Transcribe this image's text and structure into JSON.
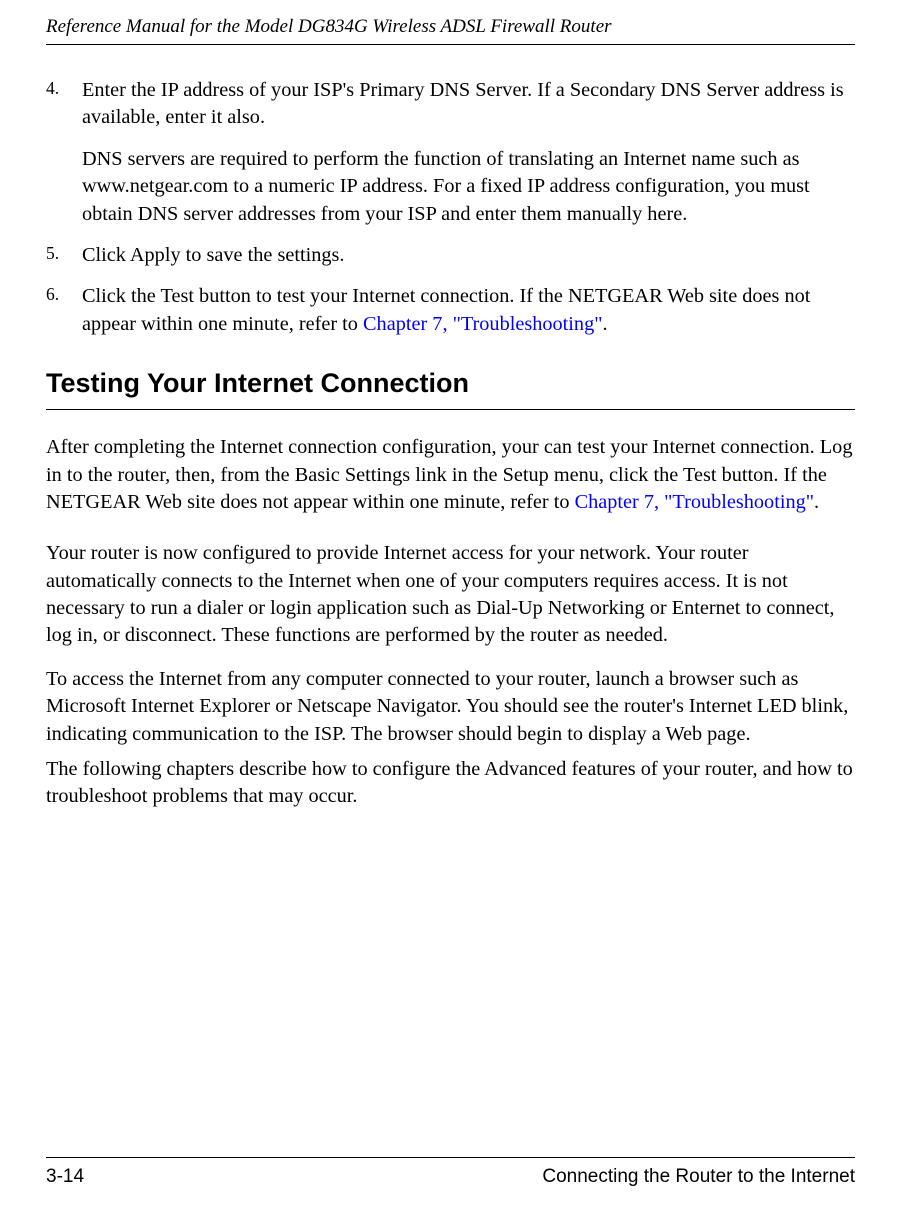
{
  "header": {
    "title": "Reference Manual for the Model DG834G Wireless ADSL Firewall Router"
  },
  "list": {
    "item4": {
      "num": "4.",
      "text": "Enter the IP address of your ISP's Primary DNS Server. If a Secondary DNS Server address is available, enter it also.",
      "sub": "DNS servers are required to perform the function of translating an Internet name such as www.netgear.com to a numeric IP address. For a fixed IP address configuration, you must obtain DNS server addresses from your ISP and enter them manually here."
    },
    "item5": {
      "num": "5.",
      "text": "Click Apply to save the settings."
    },
    "item6": {
      "num": "6.",
      "text_a": "Click the Test button to test your Internet connection. If the NETGEAR Web site does not appear within one minute, refer to ",
      "link": "Chapter 7, \"Troubleshooting\"",
      "text_b": "."
    }
  },
  "section": {
    "heading": "Testing Your Internet Connection",
    "para1_a": "After completing the Internet connection configuration, your can test your Internet connection. Log in to the router, then, from the Basic Settings link in the Setup menu, click the Test button. If the NETGEAR Web site does not appear within one minute, refer to ",
    "para1_link": "Chapter 7, \"Troubleshooting\"",
    "para1_b": ".",
    "para2": "Your router is now configured to provide Internet access for your network. Your router automatically connects to the Internet when one of your computers requires access. It is not necessary to run a dialer or login application such as Dial-Up Networking or Enternet to connect, log in, or disconnect. These functions are performed by the router as needed.",
    "para3": "To access the Internet from any computer connected to your router, launch a browser such as Microsoft Internet Explorer or Netscape Navigator. You should see the router's Internet LED blink, indicating communication to the ISP. The browser should begin to display a Web page.",
    "para4": "The following chapters describe how to configure the Advanced features of your router, and how to troubleshoot problems that may occur."
  },
  "footer": {
    "page": "3-14",
    "chapter": "Connecting the Router to the Internet"
  }
}
